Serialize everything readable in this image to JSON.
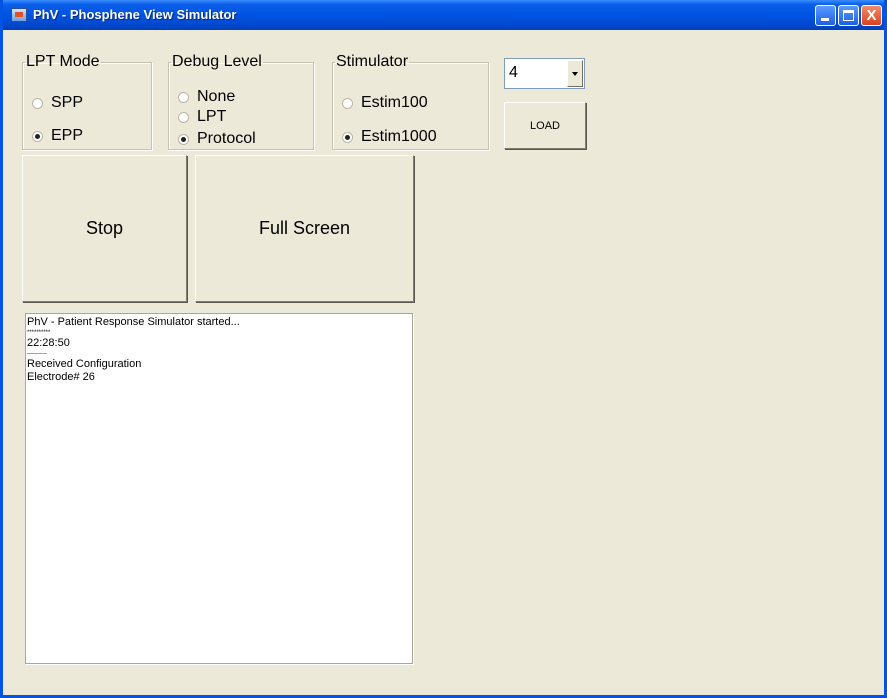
{
  "window": {
    "title": "PhV - Phosphene View Simulator",
    "controls": {
      "minimize_icon": "minimize-icon",
      "maximize_icon": "maximize-icon",
      "close_glyph": "X"
    }
  },
  "lpt_mode": {
    "legend": "LPT Mode",
    "options": [
      {
        "label": "SPP",
        "selected": false
      },
      {
        "label": "EPP",
        "selected": true
      }
    ]
  },
  "debug_level": {
    "legend": "Debug Level",
    "options": [
      {
        "label": "None",
        "selected": false
      },
      {
        "label": "LPT",
        "selected": false
      },
      {
        "label": "Protocol",
        "selected": true
      }
    ]
  },
  "stimulator": {
    "legend": "Stimulator",
    "options": [
      {
        "label": "Estim100",
        "selected": false
      },
      {
        "label": "Estim1000",
        "selected": true
      }
    ]
  },
  "combo": {
    "value": "4"
  },
  "buttons": {
    "load": "LOAD",
    "stop": "Stop",
    "full_screen": "Full Screen"
  },
  "log": {
    "lines": [
      "PhV - Patient Response Simulator started...",
      "**********",
      "22:28:50",
      "----------",
      "Received Configuration",
      "Electrode# 26"
    ]
  },
  "colors": {
    "titlebar": "#0054e3",
    "face": "#ece9d8",
    "close_button": "#d8431f"
  }
}
